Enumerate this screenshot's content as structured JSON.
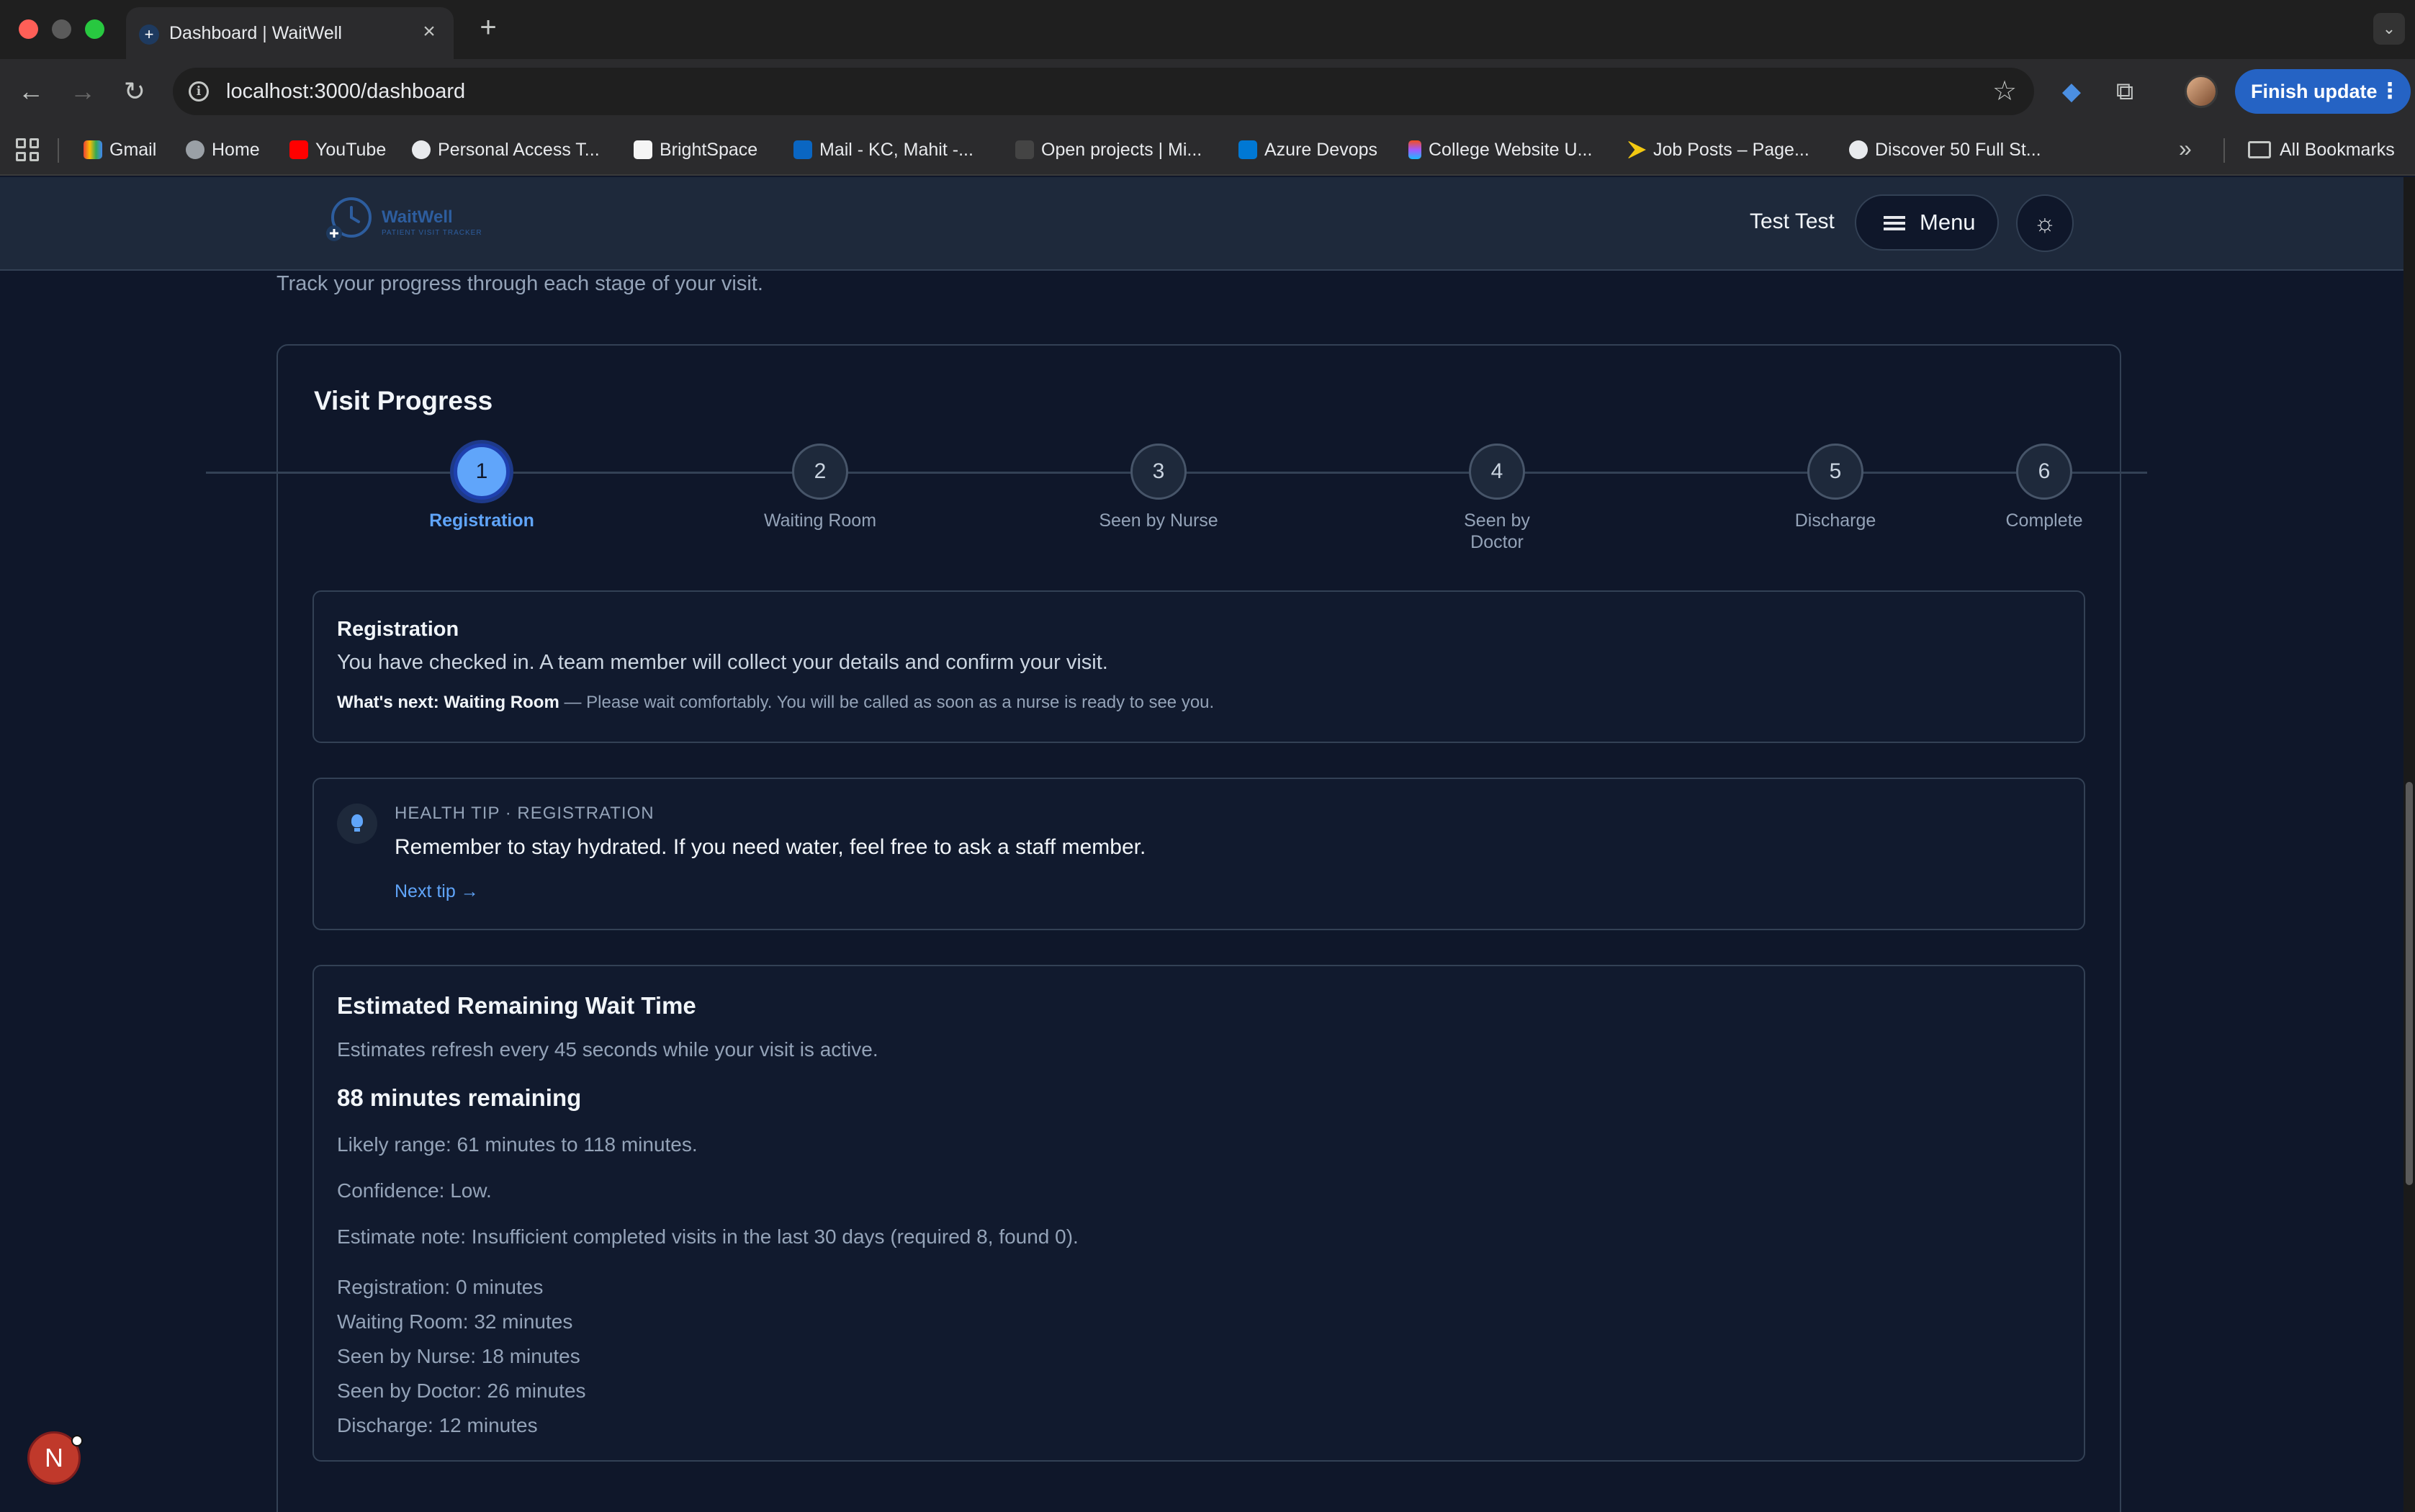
{
  "browser": {
    "tab_title": "Dashboard | WaitWell",
    "url": "localhost:3000/dashboard",
    "finish_update": "Finish update",
    "bookmarks": [
      {
        "label": "Gmail",
        "icon": "gmail-icon"
      },
      {
        "label": "Home",
        "icon": "globe-icon"
      },
      {
        "label": "YouTube",
        "icon": "youtube-icon"
      },
      {
        "label": "Personal Access T...",
        "icon": "github-icon"
      },
      {
        "label": "BrightSpace",
        "icon": "d2l-icon"
      },
      {
        "label": "Mail - KC, Mahit -...",
        "icon": "outlook-icon"
      },
      {
        "label": "Open projects | Mi...",
        "icon": "project-icon"
      },
      {
        "label": "Azure Devops",
        "icon": "azure-devops-icon"
      },
      {
        "label": "College Website U...",
        "icon": "figma-icon"
      },
      {
        "label": "Job Posts – Page...",
        "icon": "power-automate-icon"
      },
      {
        "label": "Discover 50 Full St...",
        "icon": "info-icon"
      }
    ],
    "all_bookmarks": "All Bookmarks"
  },
  "header": {
    "logo_title": "WaitWell",
    "logo_subtitle": "PATIENT VISIT TRACKER",
    "user_name": "Test Test",
    "menu_label": "Menu"
  },
  "page": {
    "subtitle": "Track your progress through each stage of your visit."
  },
  "progress": {
    "title": "Visit Progress",
    "steps": [
      {
        "number": "1",
        "label": "Registration",
        "active": true
      },
      {
        "number": "2",
        "label": "Waiting Room",
        "active": false
      },
      {
        "number": "3",
        "label": "Seen by Nurse",
        "active": false
      },
      {
        "number": "4",
        "label": "Seen by Doctor",
        "active": false
      },
      {
        "number": "5",
        "label": "Discharge",
        "active": false
      },
      {
        "number": "6",
        "label": "Complete",
        "active": false
      }
    ]
  },
  "current_stage": {
    "title": "Registration",
    "description": "You have checked in. A team member will collect your details and confirm your visit.",
    "next_label": "What's next: Waiting Room",
    "next_text": " — Please wait comfortably. You will be called as soon as a nurse is ready to see you."
  },
  "health_tip": {
    "heading": "HEALTH TIP · REGISTRATION",
    "text": "Remember to stay hydrated. If you need water, feel free to ask a staff member.",
    "next_link": "Next tip →"
  },
  "wait_time": {
    "title": "Estimated Remaining Wait Time",
    "refresh_note": "Estimates refresh every 45 seconds while your visit is active.",
    "remaining": "88 minutes remaining",
    "range": "Likely range: 61 minutes to 118 minutes.",
    "confidence": "Confidence: Low.",
    "note": "Estimate note: Insufficient completed visits in the last 30 days (required 8, found 0).",
    "breakdown": [
      "Registration: 0 minutes",
      "Waiting Room: 32 minutes",
      "Seen by Nurse: 18 minutes",
      "Seen by Doctor: 26 minutes",
      "Discharge: 12 minutes"
    ]
  },
  "floating_avatar": "N"
}
